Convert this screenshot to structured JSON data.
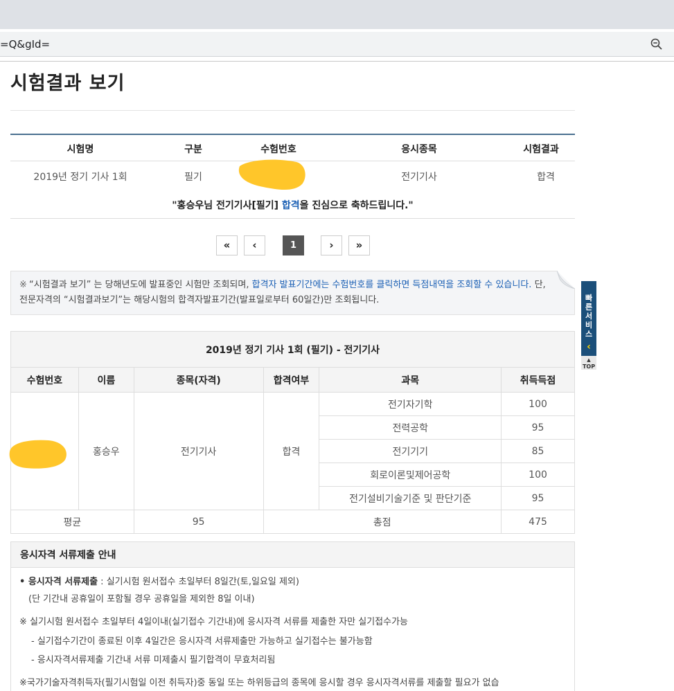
{
  "browser": {
    "address_text": "=Q&gId=",
    "zoom_icon": "zoom-out-icon"
  },
  "page": {
    "title": "시험결과 보기"
  },
  "result_table": {
    "headers": [
      "시험명",
      "구분",
      "수험번호",
      "응시종목",
      "시험결과"
    ],
    "row": {
      "exam_name": "2019년 정기 기사 1회",
      "category": "필기",
      "exam_number": "",
      "field": "전기기사",
      "result": "합격"
    },
    "congrats_prefix": "\"홍승우님 전기기사[필기] ",
    "congrats_pass": "합격",
    "congrats_suffix": "을 진심으로 축하드립니다.\""
  },
  "pagination": {
    "first": "«",
    "prev": "‹",
    "current": "1",
    "next": "›",
    "last": "»"
  },
  "notice": {
    "mark": "※",
    "part1": "“시험결과 보기” 는 당해년도에 발표중인 시험만 조회되며, ",
    "part2_blue": "합격자 발표기간에는 수험번호를 클릭하면 득점내역을 조회할 수 있습니다.",
    "part3": " 단, 전문자격의 “시험결과보기”는 해당시험의 합격자발표기간(발표일로부터 60일간)만 조회됩니다."
  },
  "quick_service": {
    "label": "빠른서비스",
    "arrow": "‹",
    "top": "TOP"
  },
  "score_table": {
    "caption": "2019년 정기 기사 1회 (필기) - 전기기사",
    "headers": [
      "수험번호",
      "이름",
      "종목(자격)",
      "합격여부",
      "과목",
      "취득득점"
    ],
    "exam_number": "",
    "name": "홍승우",
    "field": "전기기사",
    "pass": "합격",
    "subjects": [
      {
        "subject": "전기자기학",
        "score": "100"
      },
      {
        "subject": "전력공학",
        "score": "95"
      },
      {
        "subject": "전기기기",
        "score": "85"
      },
      {
        "subject": "회로이론및제어공학",
        "score": "100"
      },
      {
        "subject": "전기설비기술기준 및 판단기준",
        "score": "95"
      }
    ],
    "avg_label": "평균",
    "avg_value": "95",
    "total_label": "총점",
    "total_value": "475"
  },
  "guide": {
    "title": "응시자격 서류제출 안내",
    "line1_bold": "• 응시자격 서류제출",
    "line1_rest": " : 실기시험 원서접수 초일부터 8일간(토,일요일 제외)",
    "line2": "(단 기간내 공휴일이 포함될 경우 공휴일을 제외한 8일 이내)",
    "line3": "※ 실기시험 원서접수 초일부터 4일이내(실기접수 기간내)에 응시자격 서류를 제출한 자만 실기접수가능",
    "line4": "- 실기접수기간이 종료된 이후 4일간은 응시자격 서류제출만 가능하고 실기접수는 불가능함",
    "line5": "- 응시자격서류제출 기간내 서류 미제출시 필기합격이 무효처리됨",
    "line6": "※국가기술자격취득자(필기시험일 이전 취득자)중 동일 또는 하위등급의 종목에 응시할 경우 응시자격서류를 제출할 필요가 없습"
  },
  "colors": {
    "accent_blue": "#1a5fb4",
    "redaction": "#ffc62a",
    "quick_bg": "#1b4f7a"
  }
}
